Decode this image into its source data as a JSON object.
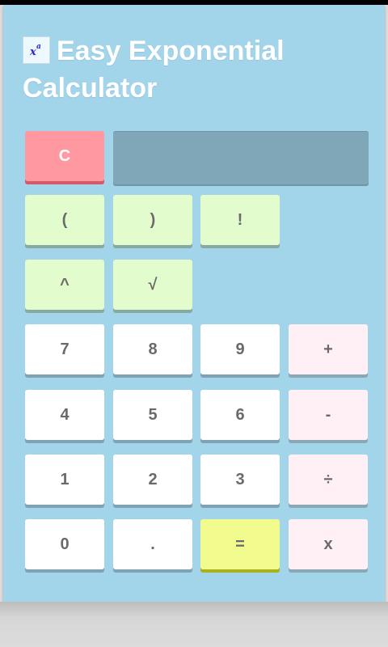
{
  "header": {
    "title": "Easy Exponential Calculator",
    "icon": "exponent-logo-icon"
  },
  "display": {
    "value": ""
  },
  "buttons": {
    "clear": "C",
    "open_paren": "(",
    "close_paren": ")",
    "factorial": "!",
    "power": "^",
    "sqrt": "√",
    "seven": "7",
    "eight": "8",
    "nine": "9",
    "plus": "+",
    "four": "4",
    "five": "5",
    "six": "6",
    "minus": "-",
    "one": "1",
    "two": "2",
    "three": "3",
    "divide": "÷",
    "zero": "0",
    "dot": ".",
    "equals": "=",
    "multiply": "x"
  },
  "colors": {
    "background": "#a2d4ea",
    "clear": "#ff98a0",
    "function_keys": "#e3fcce",
    "digit_keys": "#ffffff",
    "operator_keys": "#fff0f5",
    "equals_key": "#f1fb8e",
    "display": "#7fa7b8"
  }
}
